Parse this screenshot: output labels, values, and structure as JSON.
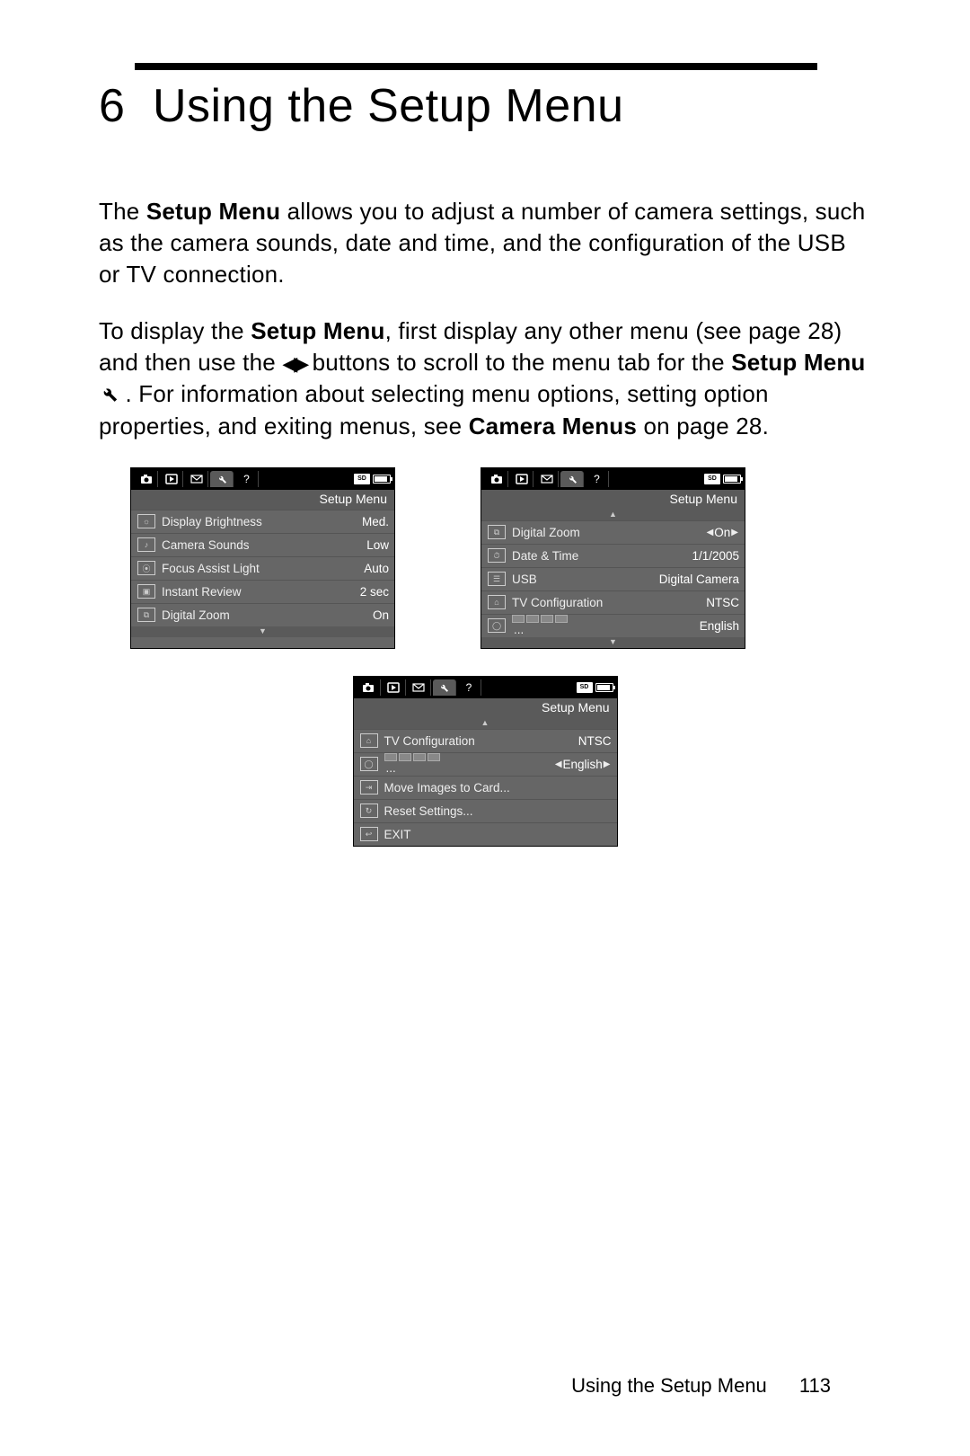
{
  "chapter": {
    "number": "6",
    "title": "Using the Setup Menu"
  },
  "para1": {
    "t1": "The ",
    "b1": "Setup Menu",
    "t2": " allows you to adjust a number of camera settings, such as the camera sounds, date and time, and the configuration of the USB or TV connection."
  },
  "para2": {
    "t1": "To display the ",
    "b1": "Setup Menu",
    "t2": ", first display any other menu (see page 28) and then use the ",
    "t3": " buttons to scroll to the menu tab for the ",
    "b2": "Setup Menu",
    "t4": ". For information about selecting menu options, setting option properties, and exiting menus, see ",
    "b3": "Camera Menus",
    "t5": " on page 28."
  },
  "screen_title": "Setup Menu",
  "screen1": [
    {
      "label": "Display Brightness",
      "value": "Med."
    },
    {
      "label": "Camera Sounds",
      "value": "Low"
    },
    {
      "label": "Focus Assist Light",
      "value": "Auto"
    },
    {
      "label": "Instant Review",
      "value": "2 sec"
    },
    {
      "label": "Digital Zoom",
      "value": "On"
    }
  ],
  "screen2": [
    {
      "label": "Digital Zoom",
      "value": "On",
      "arrows": true
    },
    {
      "label": "Date & Time",
      "value": "1/1/2005"
    },
    {
      "label": "USB",
      "value": "Digital Camera"
    },
    {
      "label": "TV Configuration",
      "value": "NTSC"
    },
    {
      "label": "",
      "value": "English",
      "flags": true
    }
  ],
  "screen3": [
    {
      "label": "TV Configuration",
      "value": "NTSC"
    },
    {
      "label": "",
      "value": "English",
      "flags": true,
      "arrows": true
    },
    {
      "label": "Move Images to Card...",
      "value": ""
    },
    {
      "label": "Reset Settings...",
      "value": ""
    },
    {
      "label": "EXIT",
      "value": ""
    }
  ],
  "sd_label": "SD",
  "footer": {
    "section": "Using the Setup Menu",
    "page": "113"
  }
}
